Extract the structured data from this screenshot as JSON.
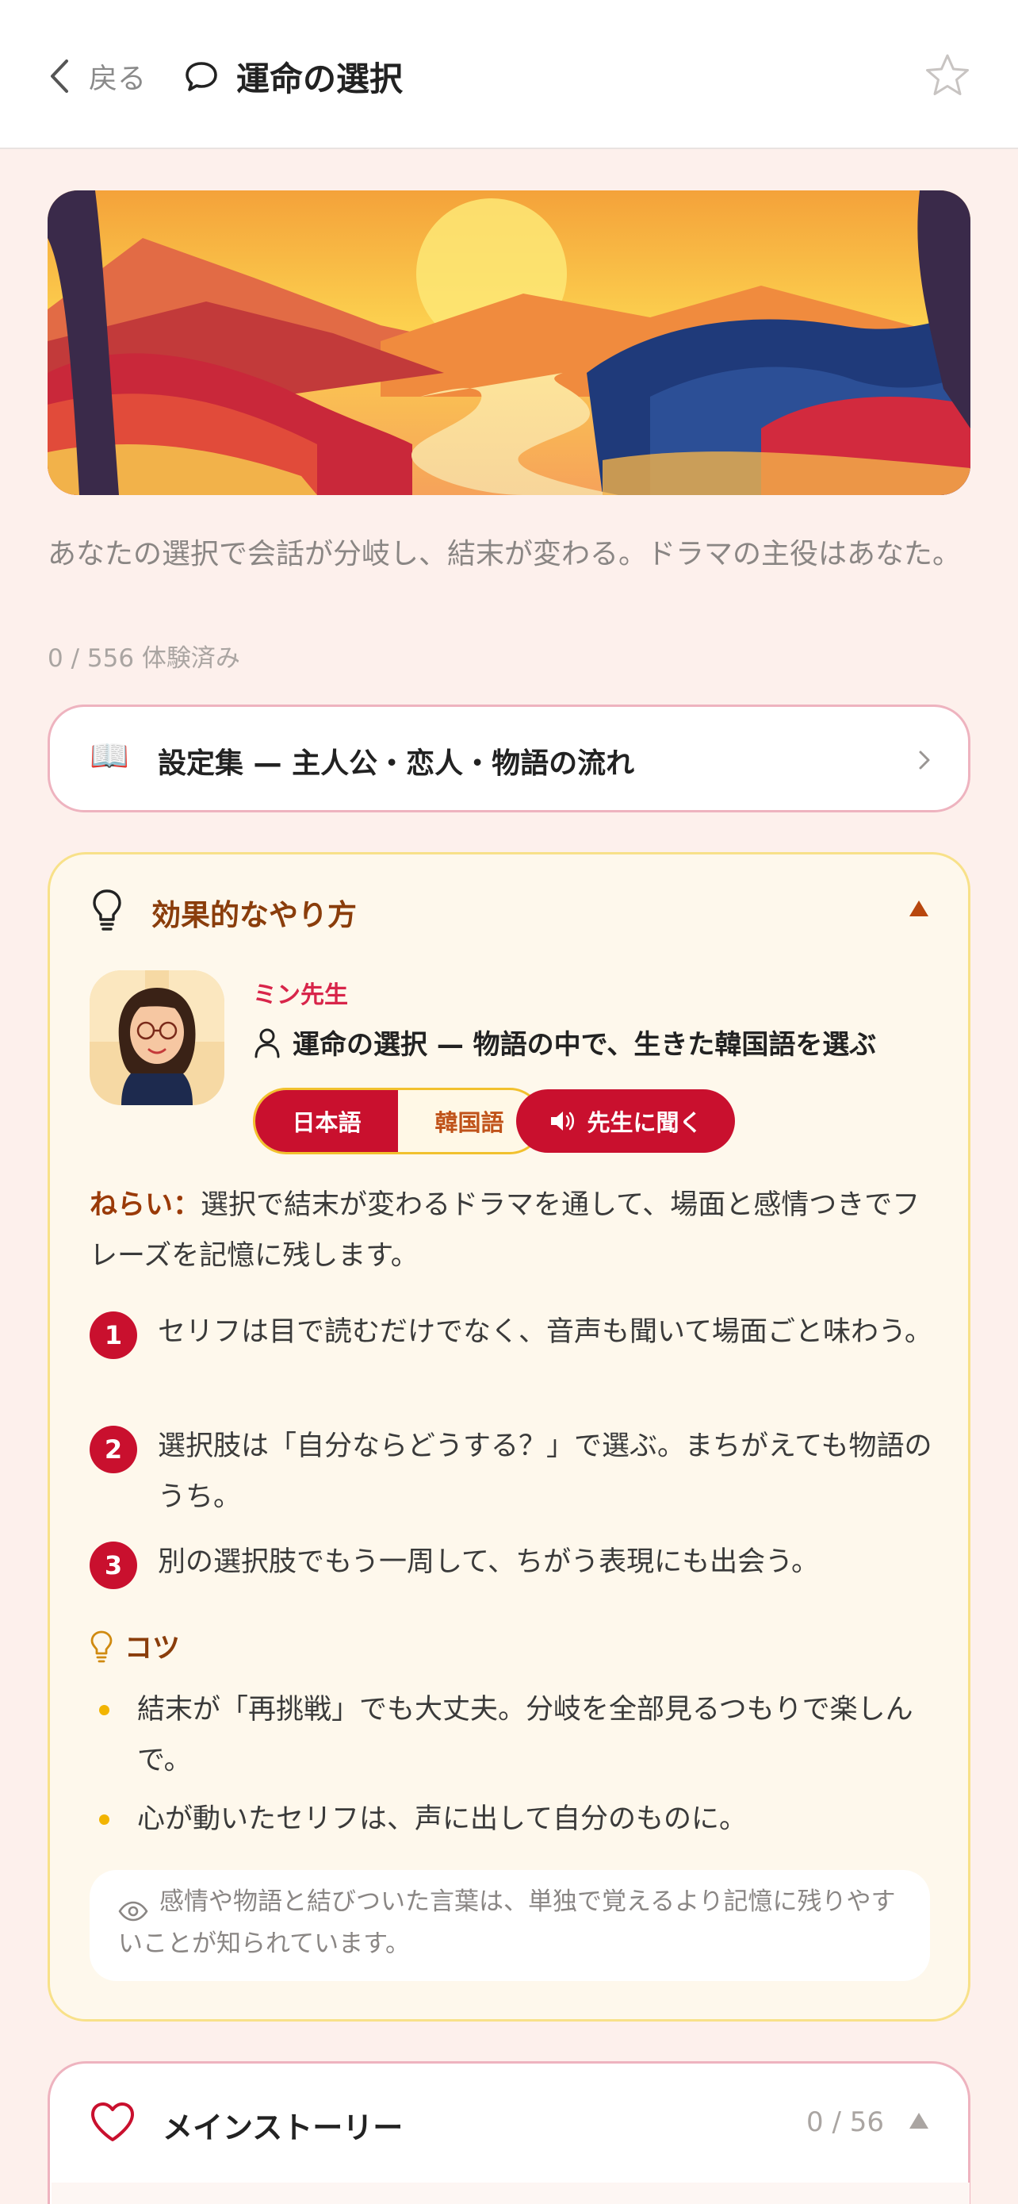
{
  "header": {
    "back_label": "戻る",
    "title": "運命の選択"
  },
  "intro": {
    "description": "あなたの選択で会話が分岐し、結末が変わる。ドラマの主役はあなた。",
    "progress": "0 / 556 体験済み"
  },
  "settings_link": {
    "icon": "📖",
    "label": "設定集 — 主人公・恋人・物語の流れ"
  },
  "tips": {
    "title": "効果的なやり方",
    "teacher_name": "ミン先生",
    "lesson_title": "運命の選択 — 物語の中で、生きた韓国語を選ぶ",
    "lang_options": [
      "日本語",
      "韓国語"
    ],
    "lang_selected": "日本語",
    "ask_label": "先生に聞く",
    "goal_label": "ねらい：",
    "goal_text": "選択で結末が変わるドラマを通して、場面と感情つきでフレーズを記憶に残します。",
    "steps": [
      {
        "num": "1",
        "text": "セリフは目で読むだけでなく、音声も聞いて場面ごと味わう。"
      },
      {
        "num": "2",
        "text": "選択肢は「自分ならどうする？」で選ぶ。まちがえても物語のうち。"
      },
      {
        "num": "3",
        "text": "別の選択肢でもう一周して、ちがう表現にも出会う。"
      }
    ],
    "kotsu_title": "コツ",
    "kotsu": [
      "結末が「再挑戦」でも大丈夫。分岐を全部見るつもりで楽しんで。",
      "心が動いたセリフは、声に出して自分のものに。"
    ],
    "note": "感情や物語と結びついた言葉は、単独で覚えるより記憶に残りやすいことが知られています。"
  },
  "story": {
    "title": "メインストーリー",
    "count": "0 / 56"
  },
  "colors": {
    "accent_red": "#c9102e",
    "accent_brown": "#8a3d0b",
    "tips_border": "#f8e189",
    "card_border": "#eeb3bf",
    "background": "#fdf0ec"
  },
  "icons": {
    "back": "chevron-left-icon",
    "chat": "chat-bubble-icon",
    "favorite": "star-outline-icon",
    "bulb": "lightbulb-icon",
    "collapse": "triangle-up-icon",
    "person": "person-icon",
    "speaker": "speaker-icon",
    "eye": "eye-icon",
    "heart": "heart-outline-icon"
  }
}
